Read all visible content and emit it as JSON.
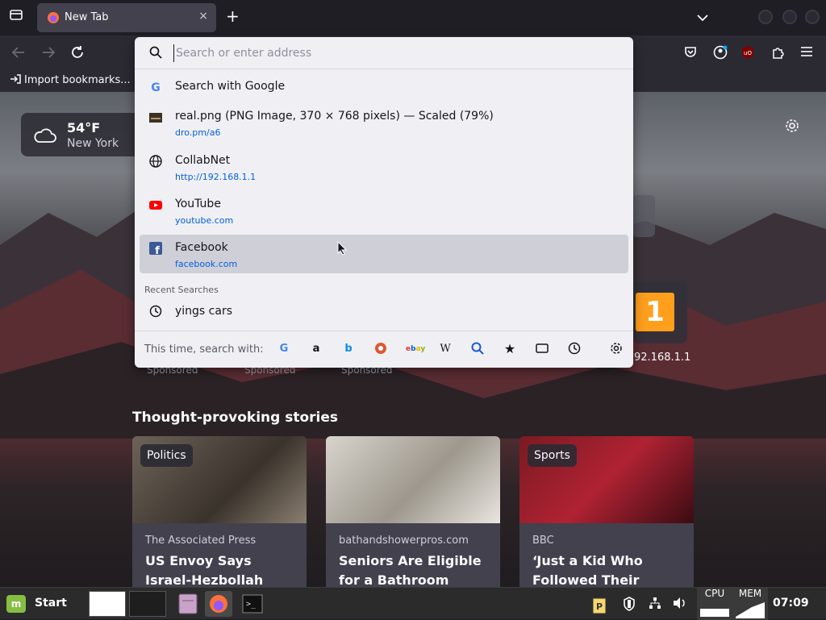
{
  "browser": {
    "tab": {
      "title": "New Tab",
      "close": "×"
    },
    "new_tab": "+",
    "bookmarks": {
      "import": "Import bookmarks..."
    }
  },
  "urlbar": {
    "placeholder": "Search or enter address",
    "value": "",
    "results": [
      {
        "icon": "google-icon",
        "label": "Search with Google",
        "url": ""
      },
      {
        "icon": "image-file-icon",
        "label": "real.png (PNG Image, 370 × 768 pixels) — Scaled (79%)",
        "url": "dro.pm/a6"
      },
      {
        "icon": "globe-icon",
        "label": "CollabNet",
        "url": "http://192.168.1.1"
      },
      {
        "icon": "youtube-icon",
        "label": "YouTube",
        "url": "youtube.com"
      },
      {
        "icon": "facebook-icon",
        "label": "Facebook",
        "url": "facebook.com",
        "selected": true
      }
    ],
    "recent_header": "Recent Searches",
    "recent": [
      {
        "icon": "history-icon",
        "label": "yings cars"
      }
    ],
    "one_off_label": "This time, search with:",
    "engines": [
      "google-icon",
      "amazon-icon",
      "bing-icon",
      "duckduckgo-icon",
      "ebay-icon",
      "wikipedia-icon",
      "search-icon",
      "bookmarks-star-icon",
      "tabs-icon",
      "history-icon",
      "settings-gear-icon"
    ]
  },
  "newtab": {
    "weather": {
      "temp": "54°F",
      "city": "New York"
    },
    "topsite_label": "92.168.1.1",
    "topsite_logo": "1",
    "sponsored": [
      "Sponsored",
      "Sponsored",
      "Sponsored"
    ],
    "stories_heading": "Thought-provoking stories",
    "cards": [
      {
        "tag": "Politics",
        "source": "The Associated Press",
        "headline": "US Envoy Says Israel-Hezbollah Truce Is"
      },
      {
        "tag": "",
        "source": "bathandshowerpros.com",
        "headline": "Seniors Are Eligible for a Bathroom"
      },
      {
        "tag": "Sports",
        "source": "BBC",
        "headline": "‘Just a Kid Who Followed Their"
      }
    ]
  },
  "taskbar": {
    "start": "Start",
    "cpu": "CPU",
    "mem": "MEM",
    "clock": "07:09"
  }
}
